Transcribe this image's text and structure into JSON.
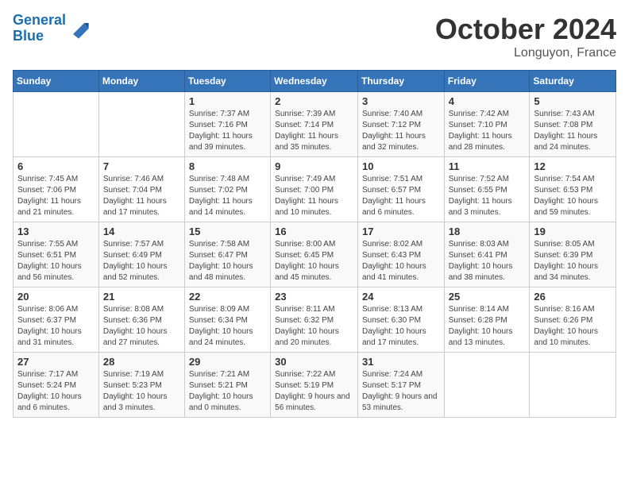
{
  "header": {
    "logo_line1": "General",
    "logo_line2": "Blue",
    "title": "October 2024",
    "subtitle": "Longuyon, France"
  },
  "weekdays": [
    "Sunday",
    "Monday",
    "Tuesday",
    "Wednesday",
    "Thursday",
    "Friday",
    "Saturday"
  ],
  "weeks": [
    [
      {
        "date": "",
        "info": ""
      },
      {
        "date": "",
        "info": ""
      },
      {
        "date": "1",
        "info": "Sunrise: 7:37 AM\nSunset: 7:16 PM\nDaylight: 11 hours and 39 minutes."
      },
      {
        "date": "2",
        "info": "Sunrise: 7:39 AM\nSunset: 7:14 PM\nDaylight: 11 hours and 35 minutes."
      },
      {
        "date": "3",
        "info": "Sunrise: 7:40 AM\nSunset: 7:12 PM\nDaylight: 11 hours and 32 minutes."
      },
      {
        "date": "4",
        "info": "Sunrise: 7:42 AM\nSunset: 7:10 PM\nDaylight: 11 hours and 28 minutes."
      },
      {
        "date": "5",
        "info": "Sunrise: 7:43 AM\nSunset: 7:08 PM\nDaylight: 11 hours and 24 minutes."
      }
    ],
    [
      {
        "date": "6",
        "info": "Sunrise: 7:45 AM\nSunset: 7:06 PM\nDaylight: 11 hours and 21 minutes."
      },
      {
        "date": "7",
        "info": "Sunrise: 7:46 AM\nSunset: 7:04 PM\nDaylight: 11 hours and 17 minutes."
      },
      {
        "date": "8",
        "info": "Sunrise: 7:48 AM\nSunset: 7:02 PM\nDaylight: 11 hours and 14 minutes."
      },
      {
        "date": "9",
        "info": "Sunrise: 7:49 AM\nSunset: 7:00 PM\nDaylight: 11 hours and 10 minutes."
      },
      {
        "date": "10",
        "info": "Sunrise: 7:51 AM\nSunset: 6:57 PM\nDaylight: 11 hours and 6 minutes."
      },
      {
        "date": "11",
        "info": "Sunrise: 7:52 AM\nSunset: 6:55 PM\nDaylight: 11 hours and 3 minutes."
      },
      {
        "date": "12",
        "info": "Sunrise: 7:54 AM\nSunset: 6:53 PM\nDaylight: 10 hours and 59 minutes."
      }
    ],
    [
      {
        "date": "13",
        "info": "Sunrise: 7:55 AM\nSunset: 6:51 PM\nDaylight: 10 hours and 56 minutes."
      },
      {
        "date": "14",
        "info": "Sunrise: 7:57 AM\nSunset: 6:49 PM\nDaylight: 10 hours and 52 minutes."
      },
      {
        "date": "15",
        "info": "Sunrise: 7:58 AM\nSunset: 6:47 PM\nDaylight: 10 hours and 48 minutes."
      },
      {
        "date": "16",
        "info": "Sunrise: 8:00 AM\nSunset: 6:45 PM\nDaylight: 10 hours and 45 minutes."
      },
      {
        "date": "17",
        "info": "Sunrise: 8:02 AM\nSunset: 6:43 PM\nDaylight: 10 hours and 41 minutes."
      },
      {
        "date": "18",
        "info": "Sunrise: 8:03 AM\nSunset: 6:41 PM\nDaylight: 10 hours and 38 minutes."
      },
      {
        "date": "19",
        "info": "Sunrise: 8:05 AM\nSunset: 6:39 PM\nDaylight: 10 hours and 34 minutes."
      }
    ],
    [
      {
        "date": "20",
        "info": "Sunrise: 8:06 AM\nSunset: 6:37 PM\nDaylight: 10 hours and 31 minutes."
      },
      {
        "date": "21",
        "info": "Sunrise: 8:08 AM\nSunset: 6:36 PM\nDaylight: 10 hours and 27 minutes."
      },
      {
        "date": "22",
        "info": "Sunrise: 8:09 AM\nSunset: 6:34 PM\nDaylight: 10 hours and 24 minutes."
      },
      {
        "date": "23",
        "info": "Sunrise: 8:11 AM\nSunset: 6:32 PM\nDaylight: 10 hours and 20 minutes."
      },
      {
        "date": "24",
        "info": "Sunrise: 8:13 AM\nSunset: 6:30 PM\nDaylight: 10 hours and 17 minutes."
      },
      {
        "date": "25",
        "info": "Sunrise: 8:14 AM\nSunset: 6:28 PM\nDaylight: 10 hours and 13 minutes."
      },
      {
        "date": "26",
        "info": "Sunrise: 8:16 AM\nSunset: 6:26 PM\nDaylight: 10 hours and 10 minutes."
      }
    ],
    [
      {
        "date": "27",
        "info": "Sunrise: 7:17 AM\nSunset: 5:24 PM\nDaylight: 10 hours and 6 minutes."
      },
      {
        "date": "28",
        "info": "Sunrise: 7:19 AM\nSunset: 5:23 PM\nDaylight: 10 hours and 3 minutes."
      },
      {
        "date": "29",
        "info": "Sunrise: 7:21 AM\nSunset: 5:21 PM\nDaylight: 10 hours and 0 minutes."
      },
      {
        "date": "30",
        "info": "Sunrise: 7:22 AM\nSunset: 5:19 PM\nDaylight: 9 hours and 56 minutes."
      },
      {
        "date": "31",
        "info": "Sunrise: 7:24 AM\nSunset: 5:17 PM\nDaylight: 9 hours and 53 minutes."
      },
      {
        "date": "",
        "info": ""
      },
      {
        "date": "",
        "info": ""
      }
    ]
  ]
}
